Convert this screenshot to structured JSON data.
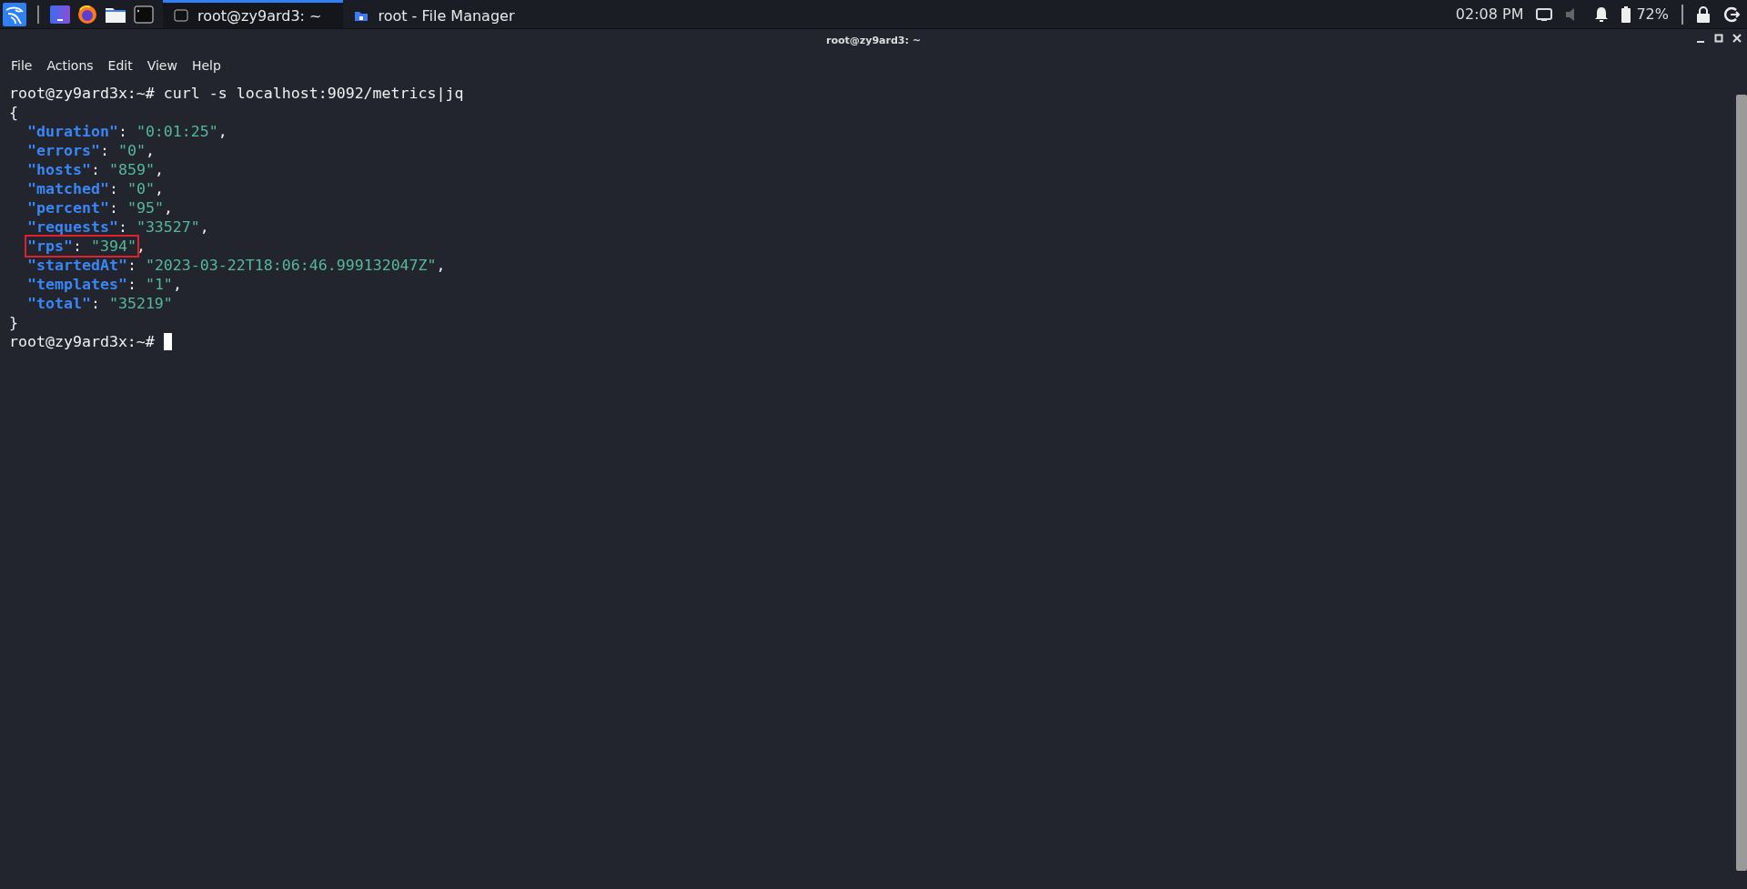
{
  "taskbar": {
    "tasks": [
      {
        "label": "root@zy9ard3: ~",
        "selected": true,
        "kind": "terminal"
      },
      {
        "label": "root - File Manager",
        "selected": false,
        "kind": "folder"
      }
    ],
    "clock": "02:08 PM",
    "volume_muted": true,
    "battery": "72%"
  },
  "window": {
    "title": "root@zy9ard3: ~"
  },
  "menu": [
    "File",
    "Actions",
    "Edit",
    "View",
    "Help"
  ],
  "terminal": {
    "lines": [
      {
        "kind": "text",
        "text": "root@zy9ard3x:~# curl -s localhost:9092/metrics|jq"
      },
      {
        "kind": "text",
        "text": "{"
      },
      {
        "kind": "pair",
        "key": "\"duration\"",
        "colon": ":",
        "value": "\"0:01:25\"",
        "comma": ",",
        "highlighted": false
      },
      {
        "kind": "pair",
        "key": "\"errors\"",
        "colon": ":",
        "value": "\"0\"",
        "comma": ",",
        "highlighted": false
      },
      {
        "kind": "pair",
        "key": "\"hosts\"",
        "colon": ":",
        "value": "\"859\"",
        "comma": ",",
        "highlighted": false
      },
      {
        "kind": "pair",
        "key": "\"matched\"",
        "colon": ":",
        "value": "\"0\"",
        "comma": ",",
        "highlighted": false
      },
      {
        "kind": "pair",
        "key": "\"percent\"",
        "colon": ":",
        "value": "\"95\"",
        "comma": ",",
        "highlighted": false
      },
      {
        "kind": "pair",
        "key": "\"requests\"",
        "colon": ":",
        "value": "\"33527\"",
        "comma": ",",
        "highlighted": false
      },
      {
        "kind": "pair",
        "key": "\"rps\"",
        "colon": ":",
        "value": "\"394\"",
        "comma": ",",
        "highlighted": true
      },
      {
        "kind": "pair",
        "key": "\"startedAt\"",
        "colon": ":",
        "value": "\"2023-03-22T18:06:46.999132047Z\"",
        "comma": ",",
        "highlighted": false
      },
      {
        "kind": "pair",
        "key": "\"templates\"",
        "colon": ":",
        "value": "\"1\"",
        "comma": ",",
        "highlighted": false
      },
      {
        "kind": "pair",
        "key": "\"total\"",
        "colon": ":",
        "value": "\"35219\"",
        "highlighted": false
      },
      {
        "kind": "text",
        "text": "}"
      },
      {
        "kind": "prompt",
        "text": "root@zy9ard3x:~#"
      }
    ]
  }
}
